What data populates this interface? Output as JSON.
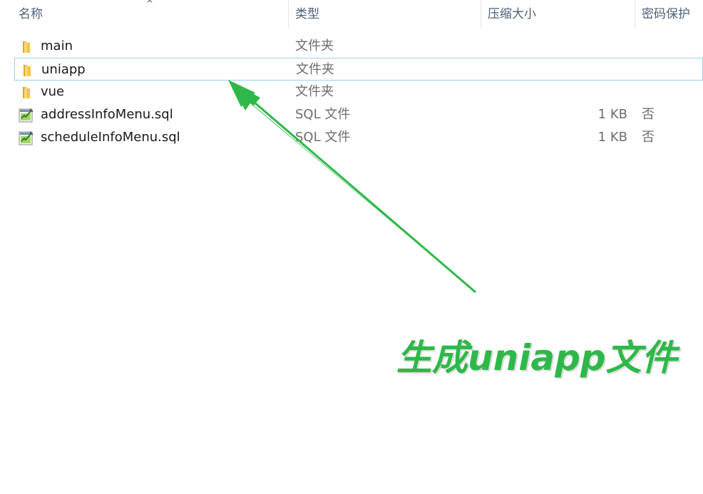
{
  "columns": {
    "name": "名称",
    "type": "类型",
    "compressed_size": "压缩大小",
    "password": "密码保护"
  },
  "sort_indicator": "^",
  "files": [
    {
      "name": "main",
      "type": "文件夹",
      "size": "",
      "password": "",
      "icon": "folder-icon",
      "selected": false
    },
    {
      "name": "uniapp",
      "type": "文件夹",
      "size": "",
      "password": "",
      "icon": "folder-icon",
      "selected": true
    },
    {
      "name": "vue",
      "type": "文件夹",
      "size": "",
      "password": "",
      "icon": "folder-icon",
      "selected": false
    },
    {
      "name": "addressInfoMenu.sql",
      "type": "SQL 文件",
      "size": "1 KB",
      "password": "否",
      "icon": "sql-file-icon",
      "selected": false
    },
    {
      "name": "scheduleInfoMenu.sql",
      "type": "SQL 文件",
      "size": "1 KB",
      "password": "否",
      "icon": "sql-file-icon",
      "selected": false
    }
  ],
  "annotation": {
    "text": "生成uniapp文件",
    "color": "#2fb84a"
  },
  "colors": {
    "selection_border": "#99d1ee",
    "header_text": "#4c607a",
    "arrow": "#2fb84a"
  }
}
